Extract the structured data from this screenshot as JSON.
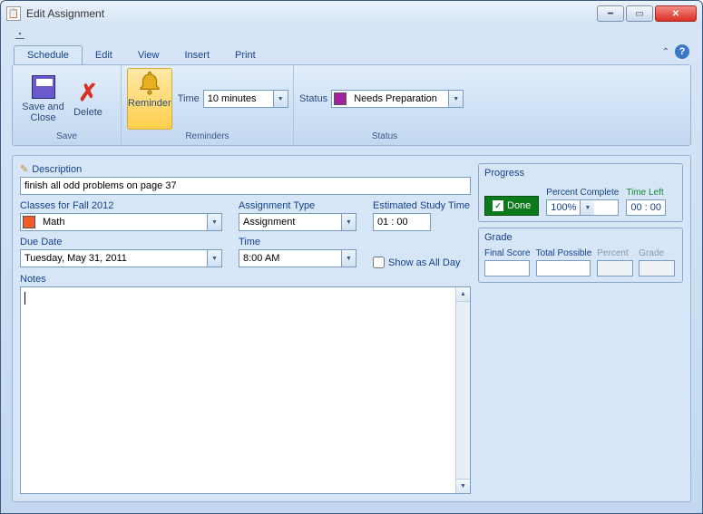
{
  "window": {
    "title": "Edit Assignment"
  },
  "tabs": {
    "schedule": "Schedule",
    "edit": "Edit",
    "view": "View",
    "insert": "Insert",
    "print": "Print"
  },
  "ribbon": {
    "save_close": "Save and Close",
    "delete": "Delete",
    "reminder": "Reminder",
    "group_save": "Save",
    "group_reminders": "Reminders",
    "group_status": "Status",
    "time_label": "Time",
    "time_value": "10 minutes",
    "status_label": "Status",
    "status_value": "Needs Preparation"
  },
  "form": {
    "description_label": "Description",
    "description_value": "finish all odd problems on page 37",
    "class_label": "Classes for Fall 2012",
    "class_value": "Math",
    "type_label": "Assignment Type",
    "type_value": "Assignment",
    "est_label": "Estimated Study Time",
    "est_value": "01 : 00",
    "due_label": "Due Date",
    "due_value": "Tuesday, May 31, 2011",
    "time_label": "Time",
    "time_value": "8:00 AM",
    "allday_label": "Show as All Day",
    "notes_label": "Notes"
  },
  "progress": {
    "title": "Progress",
    "done": "Done",
    "percent_label": "Percent Complete",
    "percent_value": "100%",
    "timeleft_label": "Time Left",
    "timeleft_value": "00 : 00"
  },
  "grade": {
    "title": "Grade",
    "final_label": "Final Score",
    "total_label": "Total Possible",
    "percent_label": "Percent",
    "grade_label": "Grade"
  }
}
